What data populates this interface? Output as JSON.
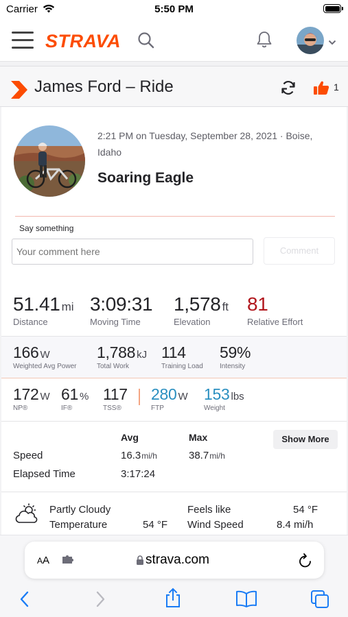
{
  "status_bar": {
    "carrier": "Carrier",
    "time": "5:50 PM"
  },
  "header": {
    "logo": "STRAVA"
  },
  "activity": {
    "title": "James Ford – Ride",
    "kudos_count": "1",
    "datetime_location": "2:21 PM on Tuesday, September 28, 2021 · Boise, Idaho",
    "name": "Soaring Eagle"
  },
  "comment": {
    "label": "Say something",
    "placeholder": "Your comment here",
    "button": "Comment"
  },
  "primary_stats": [
    {
      "value": "51.41",
      "unit": "mi",
      "label": "Distance"
    },
    {
      "value": "3:09:31",
      "unit": "",
      "label": "Moving Time"
    },
    {
      "value": "1,578",
      "unit": "ft",
      "label": "Elevation"
    },
    {
      "value": "81",
      "unit": "",
      "label": "Relative Effort"
    }
  ],
  "power_stats": [
    {
      "value": "166",
      "unit": "W",
      "label": "Weighted Avg Power"
    },
    {
      "value": "1,788",
      "unit": "kJ",
      "label": "Total Work"
    },
    {
      "value": "114",
      "unit": "",
      "label": "Training Load"
    },
    {
      "value": "59%",
      "unit": "",
      "label": "Intensity"
    }
  ],
  "premium_stats": [
    {
      "value": "172",
      "unit": "W",
      "label": "NP®"
    },
    {
      "value": "61",
      "unit": "%",
      "label": "IF®"
    },
    {
      "value": "117",
      "unit": "",
      "label": "TSS®"
    },
    {
      "value": "280",
      "unit": "W",
      "label": "FTP"
    },
    {
      "value": "153",
      "unit": "lbs",
      "label": "Weight"
    }
  ],
  "details": {
    "col_avg": "Avg",
    "col_max": "Max",
    "show_more": "Show More",
    "speed_label": "Speed",
    "speed_avg": "16.3",
    "speed_avg_unit": "mi/h",
    "speed_max": "38.7",
    "speed_max_unit": "mi/h",
    "elapsed_label": "Elapsed Time",
    "elapsed_value": "3:17:24"
  },
  "weather": {
    "condition": "Partly Cloudy",
    "temperature_label": "Temperature",
    "temperature_value": "54 °F",
    "feels_like_label": "Feels like",
    "feels_like_value": "54 °F",
    "wind_label": "Wind Speed",
    "wind_value": "8.4 mi/h"
  },
  "browser": {
    "aa_small": "A",
    "aa_big": "A",
    "url": "strava.com"
  },
  "colors": {
    "brand": "#fc4c02",
    "relative_effort": "#b1171d",
    "premium_blue": "#2a8fc0"
  }
}
